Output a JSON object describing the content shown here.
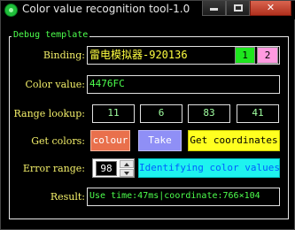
{
  "window": {
    "title": "Color value recognition tool-1.0",
    "close_label": "✕"
  },
  "group": {
    "legend": "Debug template"
  },
  "binding": {
    "label": "Binding:",
    "value": "雷电模拟器-920136",
    "chip1": "1",
    "chip2": "2"
  },
  "color_value": {
    "label": "Color value:",
    "value": "4476FC"
  },
  "range_lookup": {
    "label": "Range lookup:",
    "values": [
      "11",
      "6",
      "83",
      "41"
    ]
  },
  "get_colors": {
    "label": "Get colors:",
    "colour_button": "colour",
    "take_button": "Take",
    "get_coordinates_button": "Get coordinates"
  },
  "error_range": {
    "label": "Error range:",
    "value": "98",
    "identify_button": "Identifying color values"
  },
  "result": {
    "label": "Result:",
    "value": "Use time:47ms|coordinate:766×104"
  },
  "colors": {
    "chip1": "#1ee61e",
    "chip2": "#ff9ae0",
    "label_text": "#f4f06a",
    "field_text": "#4dff4d"
  }
}
